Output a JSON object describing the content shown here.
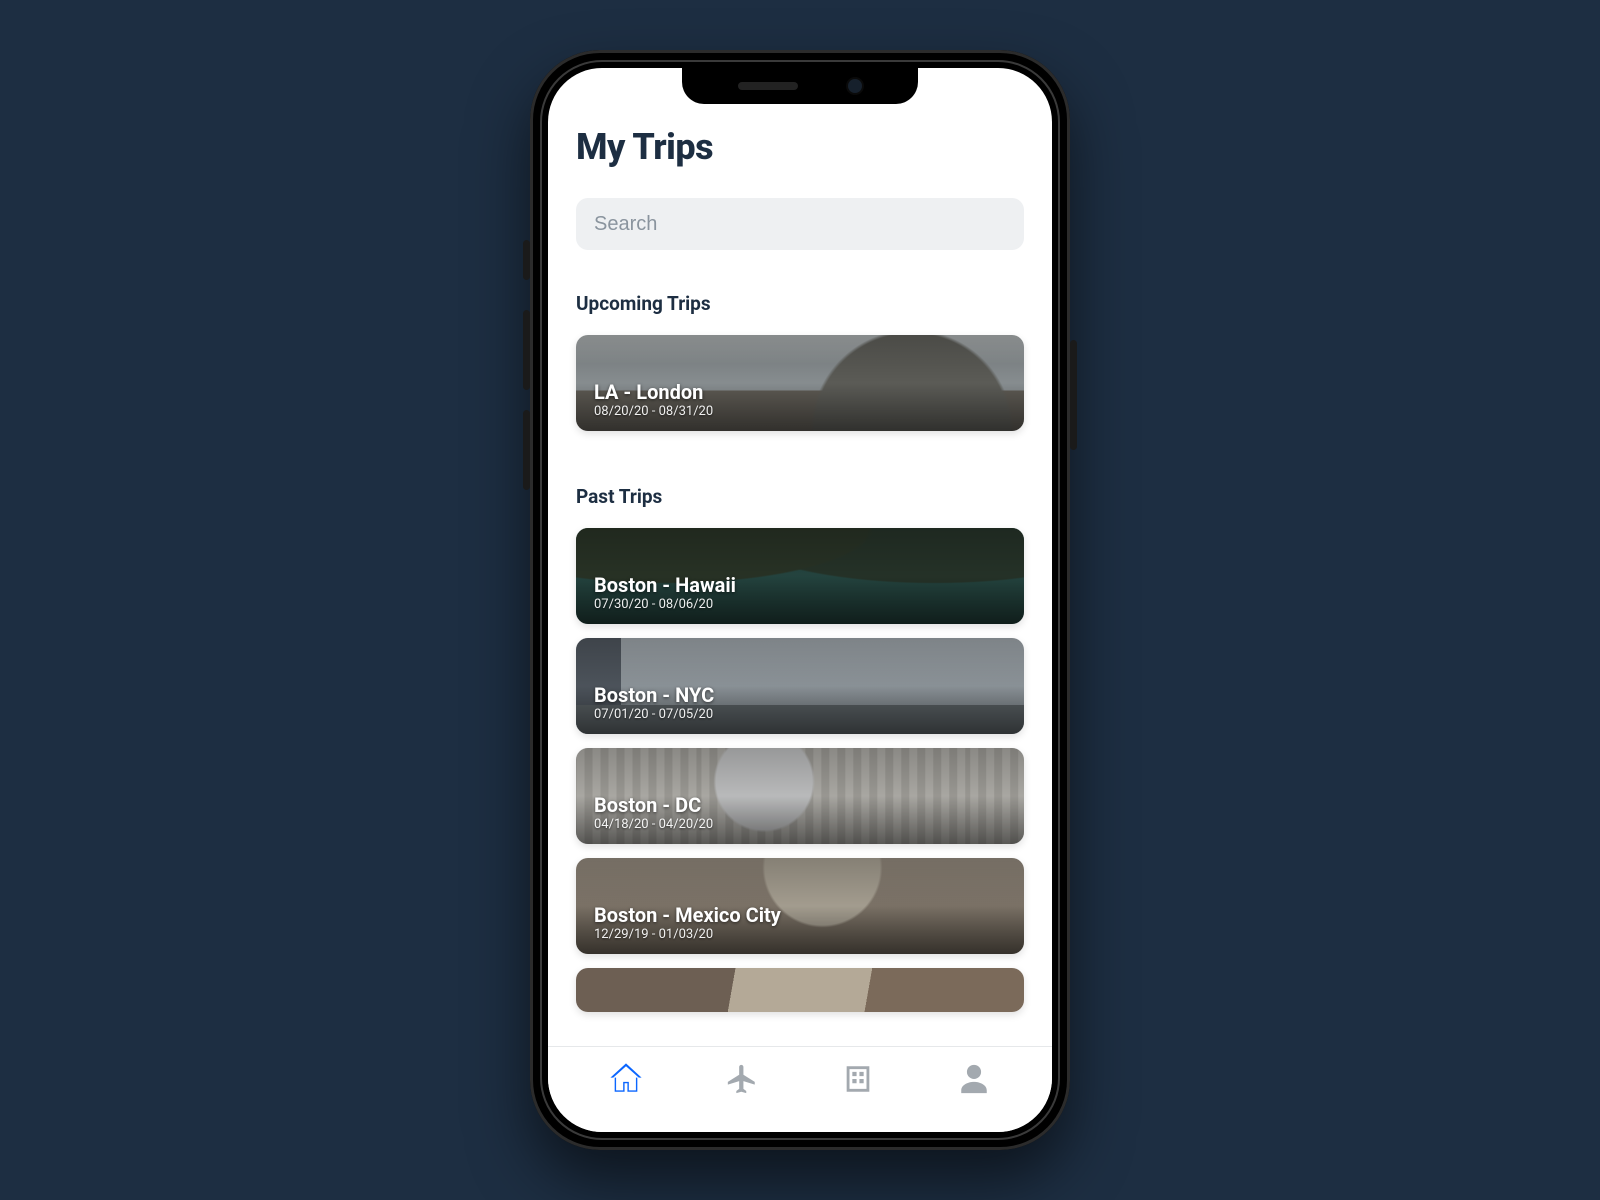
{
  "header": {
    "title": "My Trips"
  },
  "search": {
    "placeholder": "Search",
    "value": ""
  },
  "sections": {
    "upcoming": {
      "heading": "Upcoming Trips",
      "trips": [
        {
          "title": "LA - London",
          "dates": "08/20/20 - 08/31/20"
        }
      ]
    },
    "past": {
      "heading": "Past Trips",
      "trips": [
        {
          "title": "Boston - Hawaii",
          "dates": "07/30/20 - 08/06/20"
        },
        {
          "title": "Boston - NYC",
          "dates": "07/01/20 - 07/05/20"
        },
        {
          "title": "Boston - DC",
          "dates": "04/18/20 - 04/20/20"
        },
        {
          "title": "Boston - Mexico City",
          "dates": "12/29/19 - 01/03/20"
        }
      ]
    }
  },
  "tabs": {
    "items": [
      "home",
      "flights",
      "hotels",
      "profile"
    ],
    "active": "home"
  },
  "colors": {
    "accent": "#0b66ff",
    "text": "#1d2e42",
    "background": "#1d2e42"
  }
}
